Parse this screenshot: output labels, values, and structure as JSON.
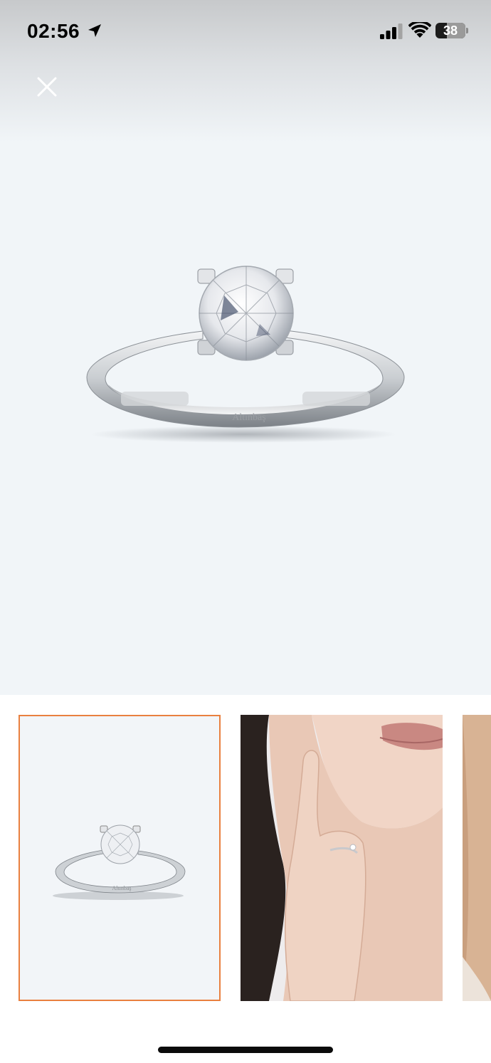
{
  "status_bar": {
    "time": "02:56",
    "battery_level": "38",
    "battery_percent": 38,
    "icons": [
      "location-arrow-icon",
      "cellular-signal-icon",
      "wifi-icon",
      "battery-icon"
    ]
  },
  "viewer": {
    "close_icon": "close-icon",
    "background_color": "#f1f5f8"
  },
  "main_image": {
    "engraving": "Altınbaş"
  },
  "thumbnails": {
    "selected_index": 0,
    "accent_color": "#e9803f",
    "items": [
      {
        "engraving": "Altınbaş"
      },
      {},
      {}
    ]
  }
}
